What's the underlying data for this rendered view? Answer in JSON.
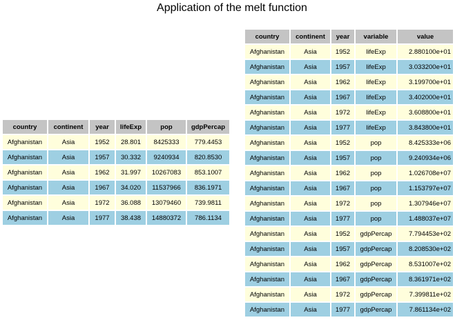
{
  "title": "Application of the melt function",
  "colors": {
    "header_bg": "#c4c4c4",
    "row_odd": "#fffedc",
    "row_even": "#9ecfe2"
  },
  "left_table": {
    "columns": [
      "country",
      "continent",
      "year",
      "lifeExp",
      "pop",
      "gdpPercap"
    ],
    "rows": [
      [
        "Afghanistan",
        "Asia",
        "1952",
        "28.801",
        "8425333",
        "779.4453"
      ],
      [
        "Afghanistan",
        "Asia",
        "1957",
        "30.332",
        "9240934",
        "820.8530"
      ],
      [
        "Afghanistan",
        "Asia",
        "1962",
        "31.997",
        "10267083",
        "853.1007"
      ],
      [
        "Afghanistan",
        "Asia",
        "1967",
        "34.020",
        "11537966",
        "836.1971"
      ],
      [
        "Afghanistan",
        "Asia",
        "1972",
        "36.088",
        "13079460",
        "739.9811"
      ],
      [
        "Afghanistan",
        "Asia",
        "1977",
        "38.438",
        "14880372",
        "786.1134"
      ]
    ]
  },
  "right_table": {
    "columns": [
      "country",
      "continent",
      "year",
      "variable",
      "value"
    ],
    "rows": [
      [
        "Afghanistan",
        "Asia",
        "1952",
        "lifeExp",
        "2.880100e+01"
      ],
      [
        "Afghanistan",
        "Asia",
        "1957",
        "lifeExp",
        "3.033200e+01"
      ],
      [
        "Afghanistan",
        "Asia",
        "1962",
        "lifeExp",
        "3.199700e+01"
      ],
      [
        "Afghanistan",
        "Asia",
        "1967",
        "lifeExp",
        "3.402000e+01"
      ],
      [
        "Afghanistan",
        "Asia",
        "1972",
        "lifeExp",
        "3.608800e+01"
      ],
      [
        "Afghanistan",
        "Asia",
        "1977",
        "lifeExp",
        "3.843800e+01"
      ],
      [
        "Afghanistan",
        "Asia",
        "1952",
        "pop",
        "8.425333e+06"
      ],
      [
        "Afghanistan",
        "Asia",
        "1957",
        "pop",
        "9.240934e+06"
      ],
      [
        "Afghanistan",
        "Asia",
        "1962",
        "pop",
        "1.026708e+07"
      ],
      [
        "Afghanistan",
        "Asia",
        "1967",
        "pop",
        "1.153797e+07"
      ],
      [
        "Afghanistan",
        "Asia",
        "1972",
        "pop",
        "1.307946e+07"
      ],
      [
        "Afghanistan",
        "Asia",
        "1977",
        "pop",
        "1.488037e+07"
      ],
      [
        "Afghanistan",
        "Asia",
        "1952",
        "gdpPercap",
        "7.794453e+02"
      ],
      [
        "Afghanistan",
        "Asia",
        "1957",
        "gdpPercap",
        "8.208530e+02"
      ],
      [
        "Afghanistan",
        "Asia",
        "1962",
        "gdpPercap",
        "8.531007e+02"
      ],
      [
        "Afghanistan",
        "Asia",
        "1967",
        "gdpPercap",
        "8.361971e+02"
      ],
      [
        "Afghanistan",
        "Asia",
        "1972",
        "gdpPercap",
        "7.399811e+02"
      ],
      [
        "Afghanistan",
        "Asia",
        "1977",
        "gdpPercap",
        "7.861134e+02"
      ]
    ]
  }
}
